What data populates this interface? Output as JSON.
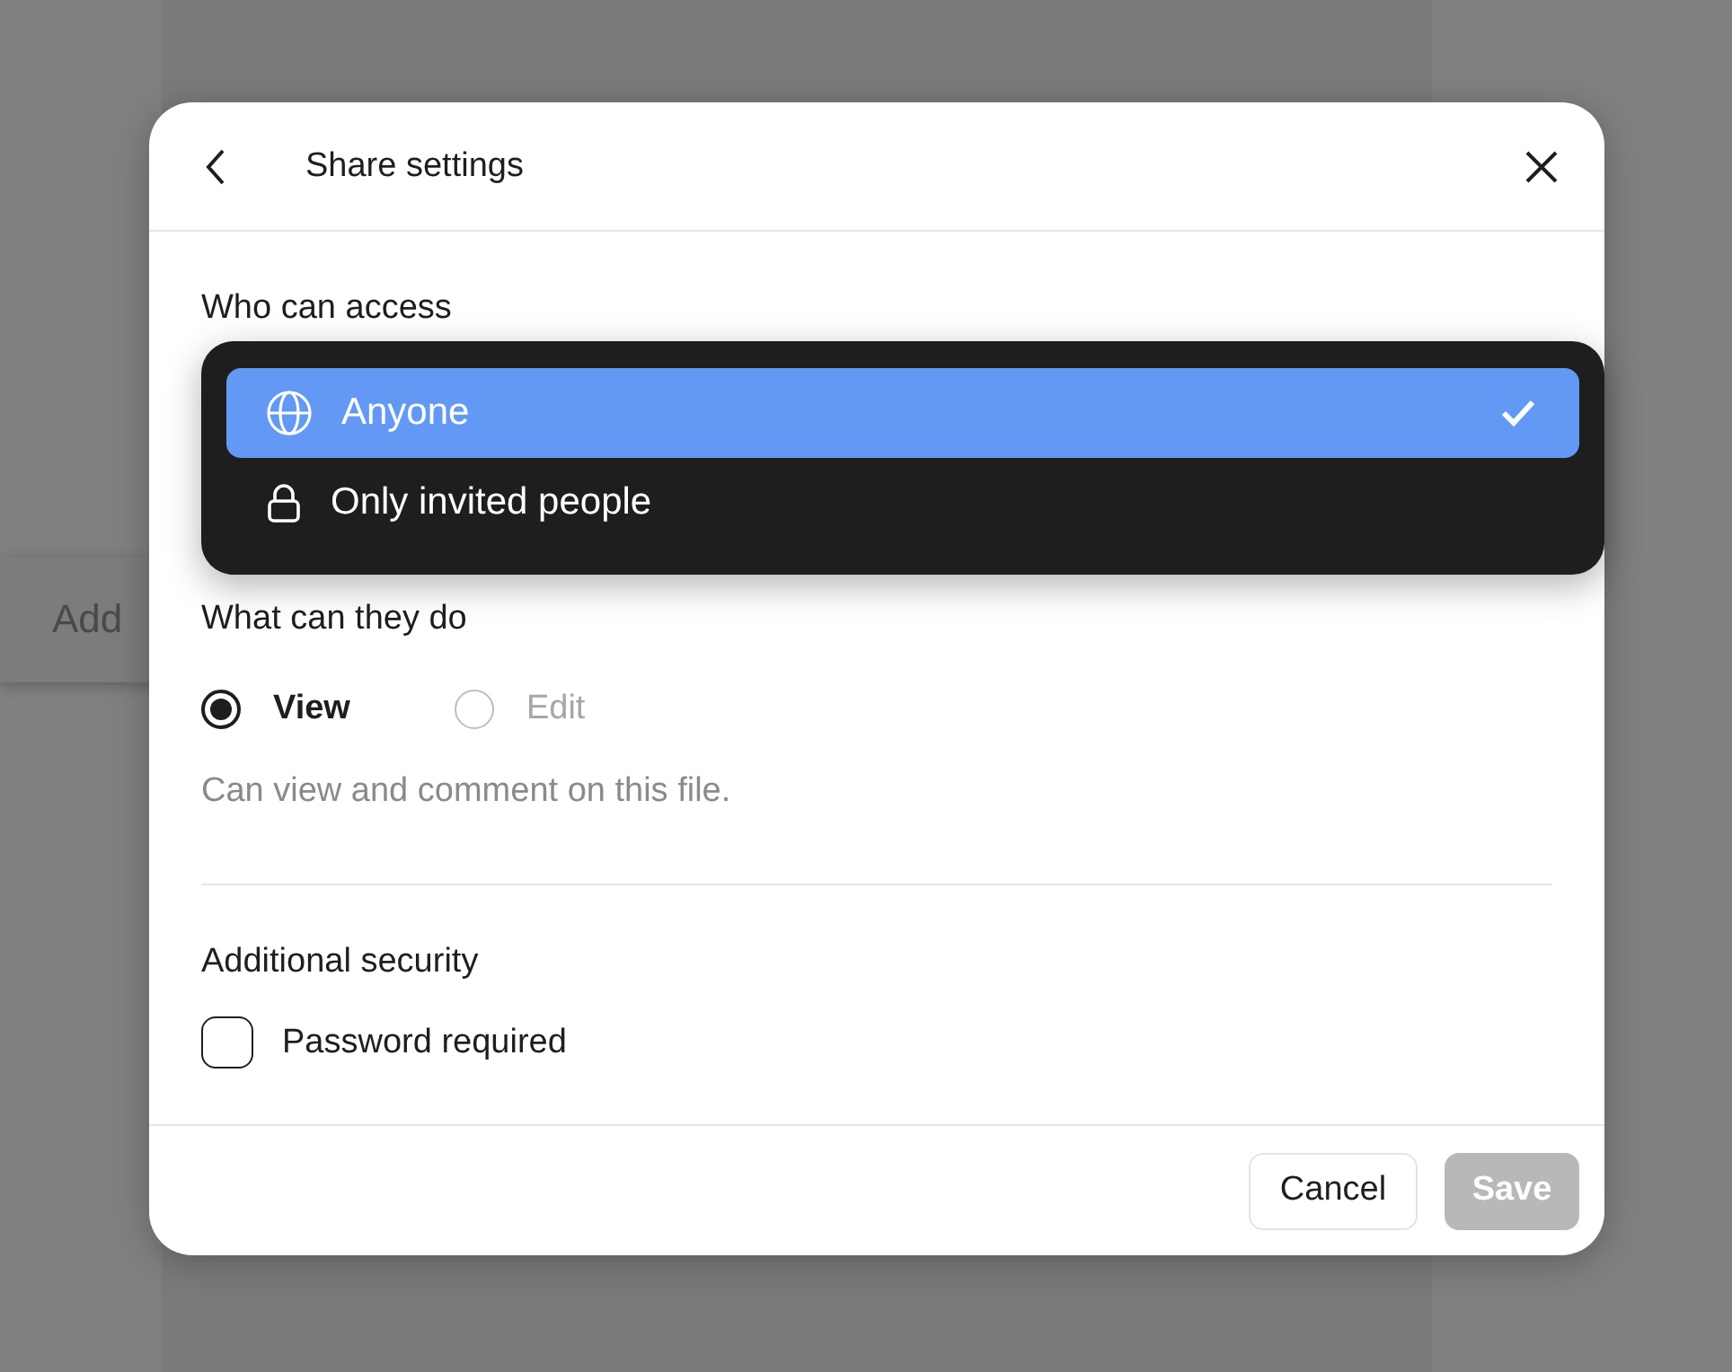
{
  "background": {
    "input_placeholder": "Add"
  },
  "dialog": {
    "title": "Share settings",
    "access": {
      "label": "Who can access",
      "options": [
        {
          "label": "Anyone",
          "kind": "globe",
          "selected": true
        },
        {
          "label": "Only invited people",
          "kind": "lock",
          "selected": false
        }
      ]
    },
    "permissions": {
      "label": "What can they do",
      "options": [
        {
          "label": "View",
          "selected": true,
          "disabled": false
        },
        {
          "label": "Edit",
          "selected": false,
          "disabled": true
        }
      ],
      "description": "Can view and comment on this file."
    },
    "security": {
      "label": "Additional security",
      "password_required": {
        "label": "Password required",
        "checked": false
      }
    },
    "buttons": [
      {
        "label": "Cancel",
        "kind": "secondary",
        "disabled": false
      },
      {
        "label": "Save",
        "kind": "primary",
        "disabled": true
      }
    ]
  }
}
